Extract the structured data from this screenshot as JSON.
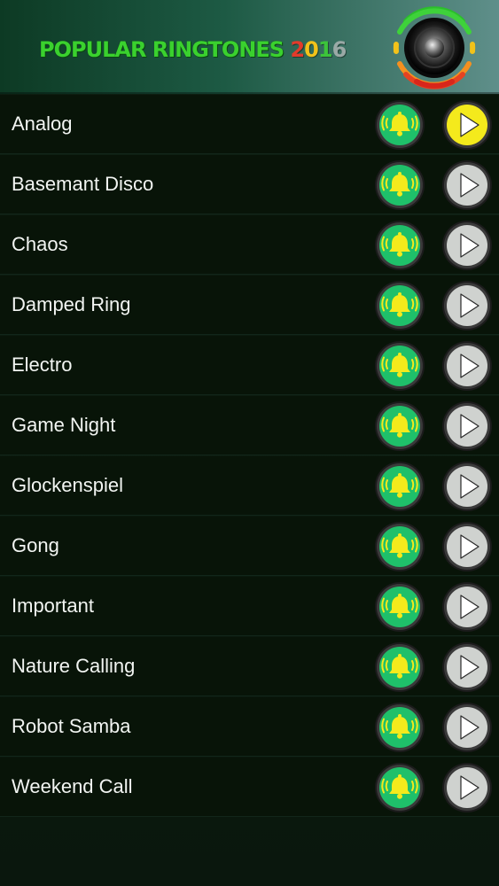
{
  "header": {
    "title_main": "POPULAR RINGTONES",
    "title_year_digits": [
      "2",
      "0",
      "1",
      "6"
    ],
    "year_colors": [
      "#e23b2b",
      "#f2c21a",
      "#3cc43a",
      "#9aa9a6"
    ]
  },
  "icons": {
    "logo": "speaker-icon",
    "set_ringtone": "bell-ringing-icon",
    "play": "play-icon"
  },
  "colors": {
    "bell_button_fill": "#1fc06a",
    "bell_color": "#f4ea1c",
    "play_active_fill": "#f4ea1c",
    "play_inactive_fill": "#cfd2cf"
  },
  "ringtones": [
    {
      "name": "Analog",
      "playing": true
    },
    {
      "name": "Basemant Disco",
      "playing": false
    },
    {
      "name": "Chaos",
      "playing": false
    },
    {
      "name": "Damped Ring",
      "playing": false
    },
    {
      "name": "Electro",
      "playing": false
    },
    {
      "name": "Game Night",
      "playing": false
    },
    {
      "name": "Glockenspiel",
      "playing": false
    },
    {
      "name": "Gong",
      "playing": false
    },
    {
      "name": "Important",
      "playing": false
    },
    {
      "name": "Nature Calling",
      "playing": false
    },
    {
      "name": "Robot Samba",
      "playing": false
    },
    {
      "name": "Weekend Call",
      "playing": false
    }
  ]
}
